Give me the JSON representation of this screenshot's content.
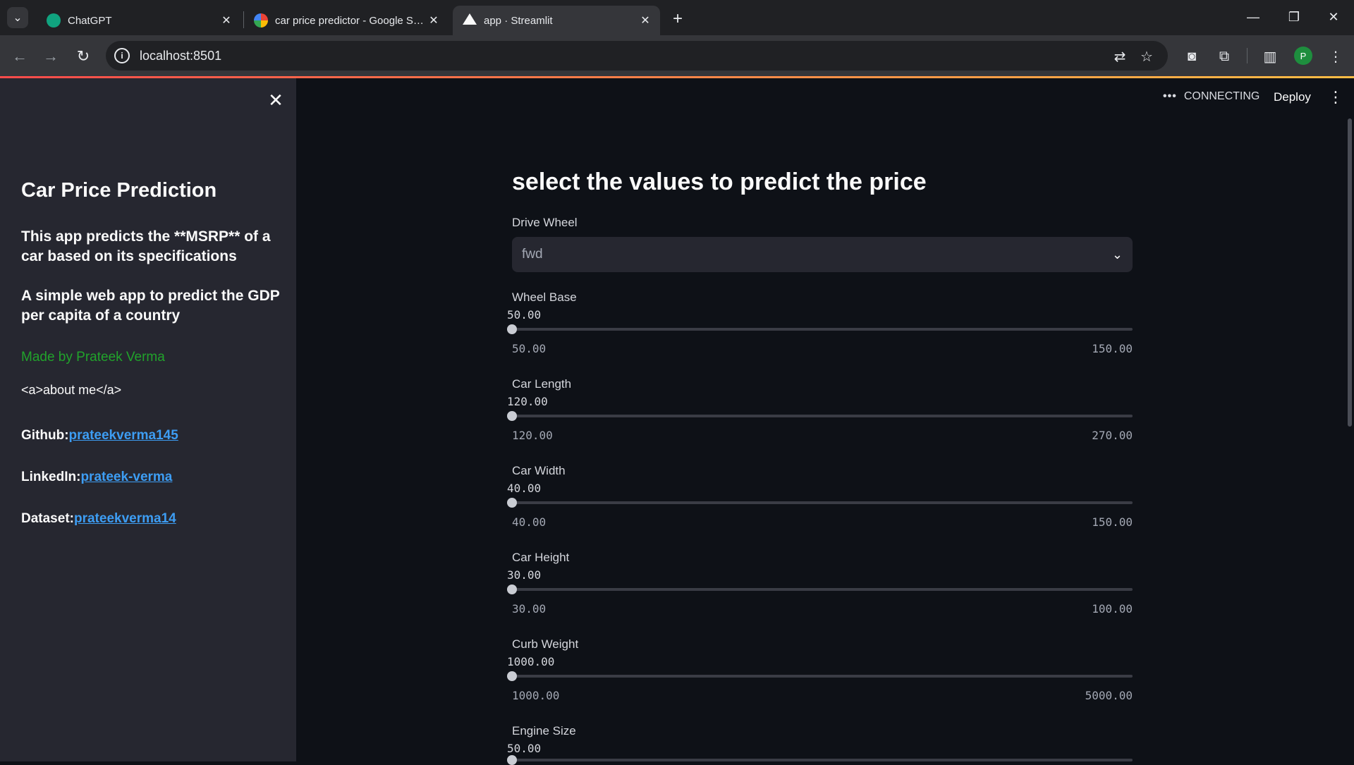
{
  "browser": {
    "tabs": [
      {
        "title": "ChatGPT",
        "icon": "chatgpt-icon"
      },
      {
        "title": "car price predictor - Google Search",
        "icon": "google-icon"
      },
      {
        "title": "app · Streamlit",
        "icon": "streamlit-icon"
      }
    ],
    "active_tab": 2,
    "url": "localhost:8501",
    "profile_initial": "P",
    "colors": {
      "tab_bar": "#202124",
      "toolbar": "#35363a",
      "profile": "#1e8e3e"
    }
  },
  "app": {
    "header": {
      "status_text": "CONNECTING",
      "deploy_label": "Deploy"
    },
    "sidebar": {
      "title": "Car Price Prediction",
      "description": "This app predicts the **MSRP** of a car based on its specifications",
      "subtitle": "A simple web app to predict the GDP per capita of a country",
      "made_by": "Made by Prateek Verma",
      "about_me": "<a>about me</a>",
      "links": [
        {
          "label": "Github:",
          "text": "prateekverma145"
        },
        {
          "label": "LinkedIn:",
          "text": "prateek-verma"
        },
        {
          "label": "Dataset:",
          "text": "prateekverma14"
        }
      ],
      "colors": {
        "background": "#262730",
        "made_by": "#21a32b",
        "link": "#3d9df3"
      }
    },
    "main": {
      "title": "select the values to predict the price",
      "drive_wheel": {
        "label": "Drive Wheel",
        "value": "fwd"
      },
      "sliders": [
        {
          "label": "Wheel Base",
          "value": "50.00",
          "min": "50.00",
          "max": "150.00",
          "fraction": 0
        },
        {
          "label": "Car Length",
          "value": "120.00",
          "min": "120.00",
          "max": "270.00",
          "fraction": 0
        },
        {
          "label": "Car Width",
          "value": "40.00",
          "min": "40.00",
          "max": "150.00",
          "fraction": 0
        },
        {
          "label": "Car Height",
          "value": "30.00",
          "min": "30.00",
          "max": "100.00",
          "fraction": 0
        },
        {
          "label": "Curb Weight",
          "value": "1000.00",
          "min": "1000.00",
          "max": "5000.00",
          "fraction": 0
        },
        {
          "label": "Engine Size",
          "value": "50.00",
          "fraction": 0
        }
      ],
      "colors": {
        "background": "#0e1117",
        "accent_gradient_start": "#ff4b4b",
        "accent_gradient_end": "#ffbd45"
      }
    }
  }
}
